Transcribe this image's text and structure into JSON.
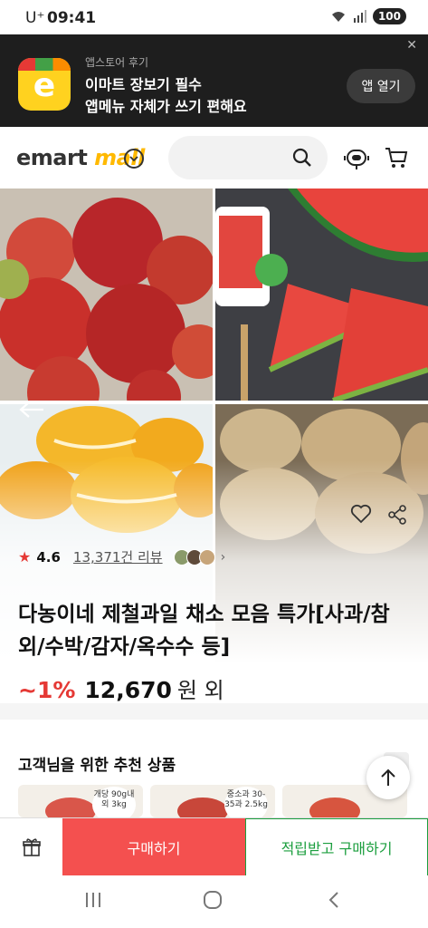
{
  "status_bar": {
    "carrier": "U⁺",
    "time": "09:41",
    "battery": "100"
  },
  "app_banner": {
    "small_text": "앱스토어 후기",
    "title": "이마트 장보기 필수",
    "subtitle": "앱메뉴 자체가 쓰기 편해요",
    "open_button": "앱 열기",
    "icon_letter": "e"
  },
  "header": {
    "logo_main": "emart",
    "logo_mall": "mall"
  },
  "product": {
    "rating": "4.6",
    "review_count": "13,371건 리뷰",
    "title": "다농이네 제철과일 채소 모음 특가[사과/참외/수박/감자/옥수수 등]",
    "discount": "~1%",
    "price": "12,670",
    "price_suffix": "원 외"
  },
  "recommend": {
    "title": "고객님을 위한 추천 상품",
    "cards": [
      {
        "tag": "개당 90g내외 3kg"
      },
      {
        "tag": "중소과 30-35과 2.5kg"
      },
      {
        "tag": ""
      }
    ]
  },
  "bottom_bar": {
    "buy": "구매하기",
    "points_buy": "적립받고 구매하기"
  },
  "colors": {
    "accent_red": "#f4504f",
    "accent_green": "#1b9e3e",
    "brand_yellow": "#ffb900"
  }
}
